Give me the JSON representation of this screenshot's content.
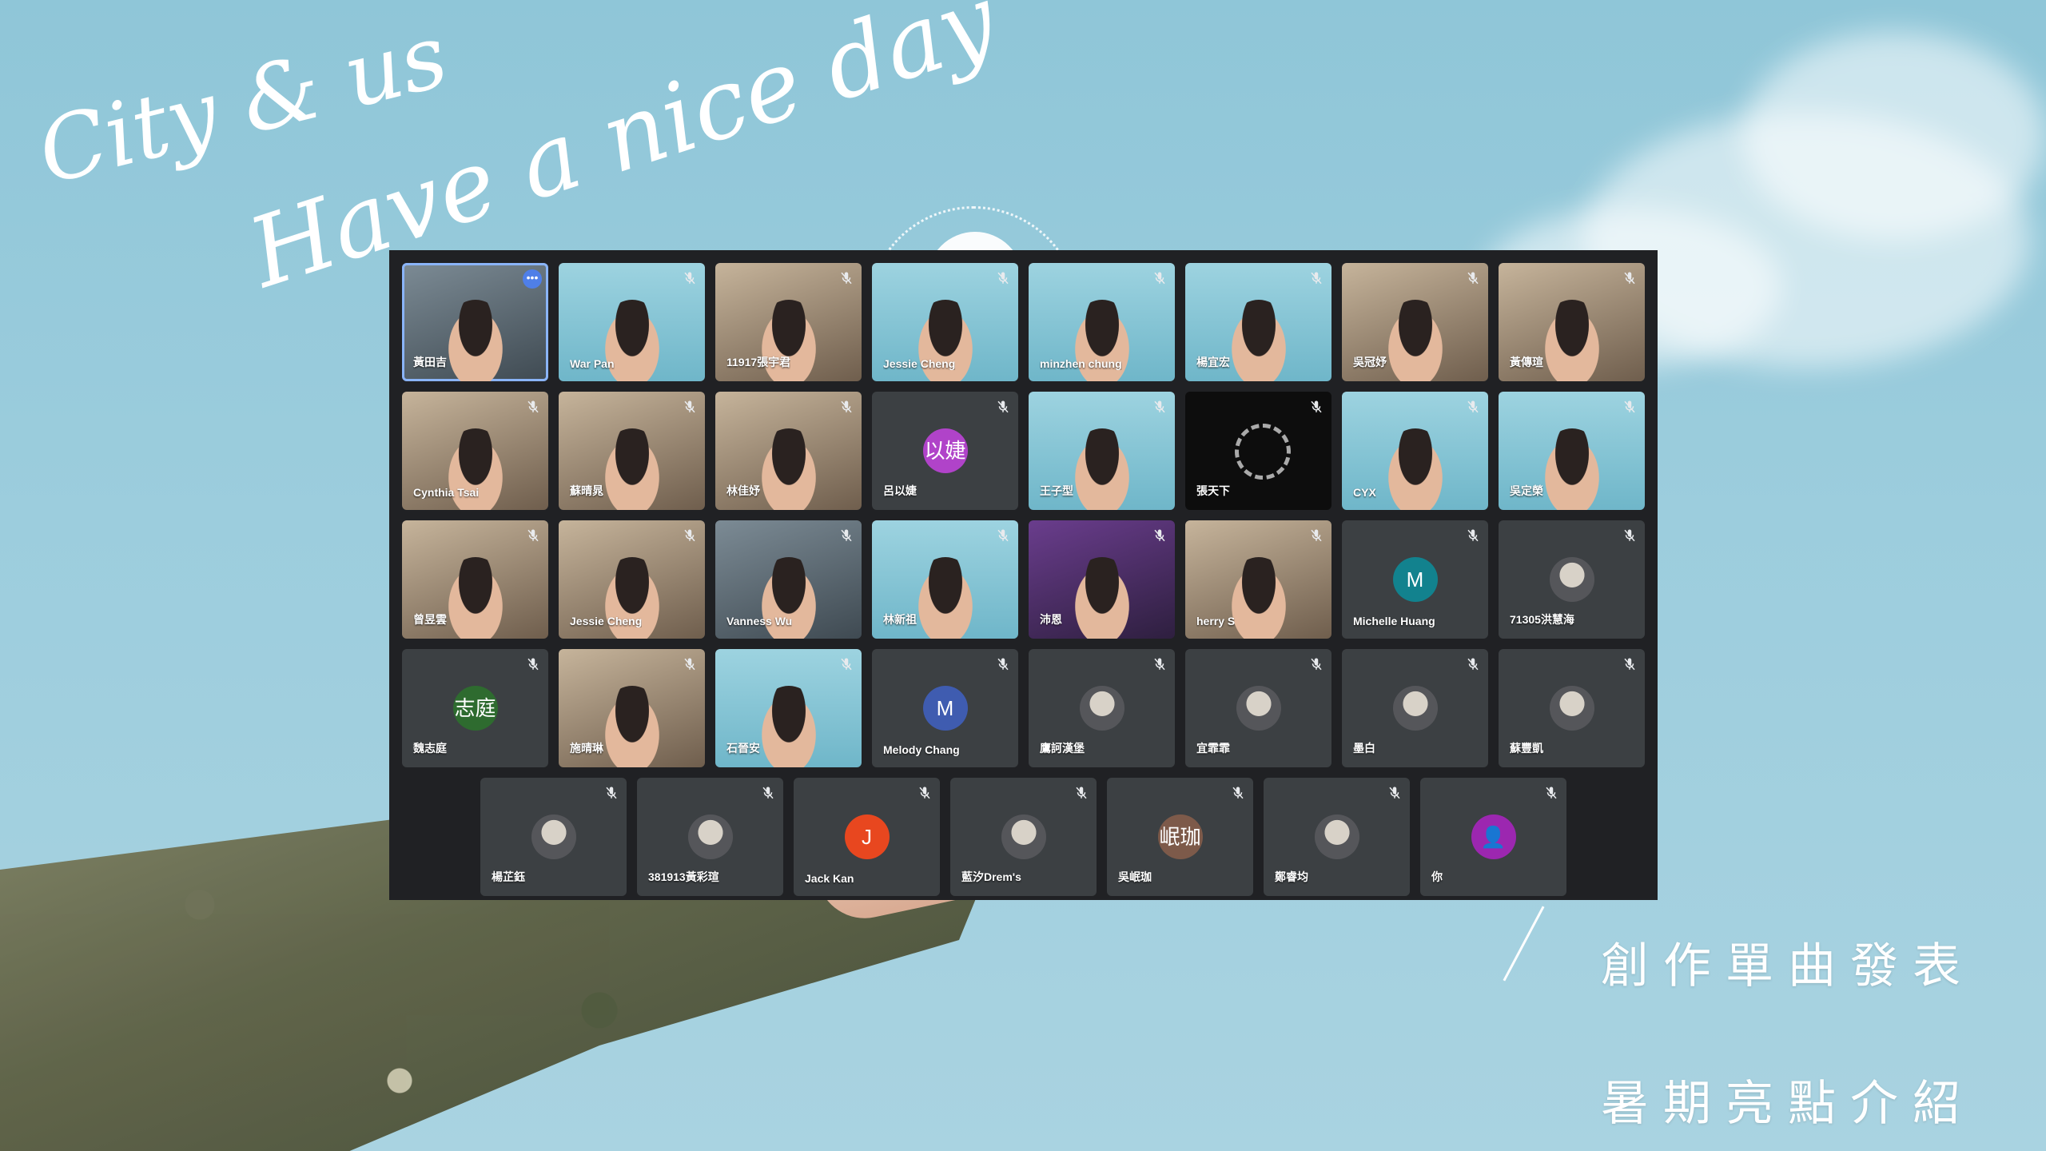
{
  "background": {
    "script_line1": "City & us",
    "script_line2": "Have a nice day",
    "caption_top": "創作單曲發表",
    "caption_bottom": "暑期亮點介紹"
  },
  "meeting": {
    "participants": [
      {
        "name": "黃田吉",
        "type": "cam",
        "style": "cam",
        "active": true,
        "more": true
      },
      {
        "name": "War Pan",
        "type": "cam",
        "style": "sky"
      },
      {
        "name": "11917張宇君",
        "type": "cam",
        "style": "room"
      },
      {
        "name": "Jessie Cheng",
        "type": "cam",
        "style": "sky"
      },
      {
        "name": "minzhen chung",
        "type": "cam",
        "style": "sky"
      },
      {
        "name": "楊宜宏",
        "type": "cam",
        "style": "sky"
      },
      {
        "name": "吳冠妤",
        "type": "cam",
        "style": "room"
      },
      {
        "name": "黃傳瑄",
        "type": "cam",
        "style": "room"
      },
      {
        "name": "Cynthia Tsai",
        "type": "cam",
        "style": "room"
      },
      {
        "name": "蘇晴晁",
        "type": "cam",
        "style": "room"
      },
      {
        "name": "林佳妤",
        "type": "cam",
        "style": "room"
      },
      {
        "name": "呂以婕",
        "type": "avatar",
        "initial": "以婕",
        "color": "#b043c9"
      },
      {
        "name": "王子型",
        "type": "cam",
        "style": "sky"
      },
      {
        "name": "張天下",
        "type": "cam",
        "style": "dark"
      },
      {
        "name": "CYX",
        "type": "cam",
        "style": "sky"
      },
      {
        "name": "吳定榮",
        "type": "cam",
        "style": "sky"
      },
      {
        "name": "曾昱雲",
        "type": "cam",
        "style": "room"
      },
      {
        "name": "Jessie Cheng",
        "type": "cam",
        "style": "room"
      },
      {
        "name": "Vanness Wu",
        "type": "cam",
        "style": "cam"
      },
      {
        "name": "林新祖",
        "type": "cam",
        "style": "sky"
      },
      {
        "name": "沛恩",
        "type": "cam",
        "style": "purple"
      },
      {
        "name": "herry S",
        "type": "cam",
        "style": "room"
      },
      {
        "name": "Michelle Huang",
        "type": "avatar",
        "initial": "M",
        "color": "#12828e"
      },
      {
        "name": "71305洪慧海",
        "type": "avatar",
        "initial": "",
        "color": "img"
      },
      {
        "name": "魏志庭",
        "type": "avatar",
        "initial": "志庭",
        "color": "#2e6b2f"
      },
      {
        "name": "施晴琳",
        "type": "cam",
        "style": "room"
      },
      {
        "name": "石晉安",
        "type": "cam",
        "style": "sky"
      },
      {
        "name": "Melody Chang",
        "type": "avatar",
        "initial": "M",
        "color": "#3f5cb0"
      },
      {
        "name": "鷹訶漢堡",
        "type": "avatar",
        "initial": "",
        "color": "img"
      },
      {
        "name": "宜霏霏",
        "type": "avatar",
        "initial": "",
        "color": "img"
      },
      {
        "name": "墨白",
        "type": "avatar",
        "initial": "",
        "color": "img"
      },
      {
        "name": "蘇豐凱",
        "type": "avatar",
        "initial": "",
        "color": "img"
      },
      {
        "name": "楊芷鈺",
        "type": "avatar",
        "initial": "",
        "color": "img"
      },
      {
        "name": "381913黃彩瑄",
        "type": "avatar",
        "initial": "",
        "color": "img"
      },
      {
        "name": "Jack Kan",
        "type": "avatar",
        "initial": "J",
        "color": "#e8471f"
      },
      {
        "name": "藍汐Drem's",
        "type": "avatar",
        "initial": "",
        "color": "img"
      },
      {
        "name": "吳岷珈",
        "type": "avatar",
        "initial": "岷珈",
        "color": "#7d5a4a"
      },
      {
        "name": "鄭睿均",
        "type": "avatar",
        "initial": "",
        "color": "img"
      },
      {
        "name": "你",
        "type": "avatar",
        "initial": "👤",
        "color": "#9c27b0"
      }
    ]
  }
}
